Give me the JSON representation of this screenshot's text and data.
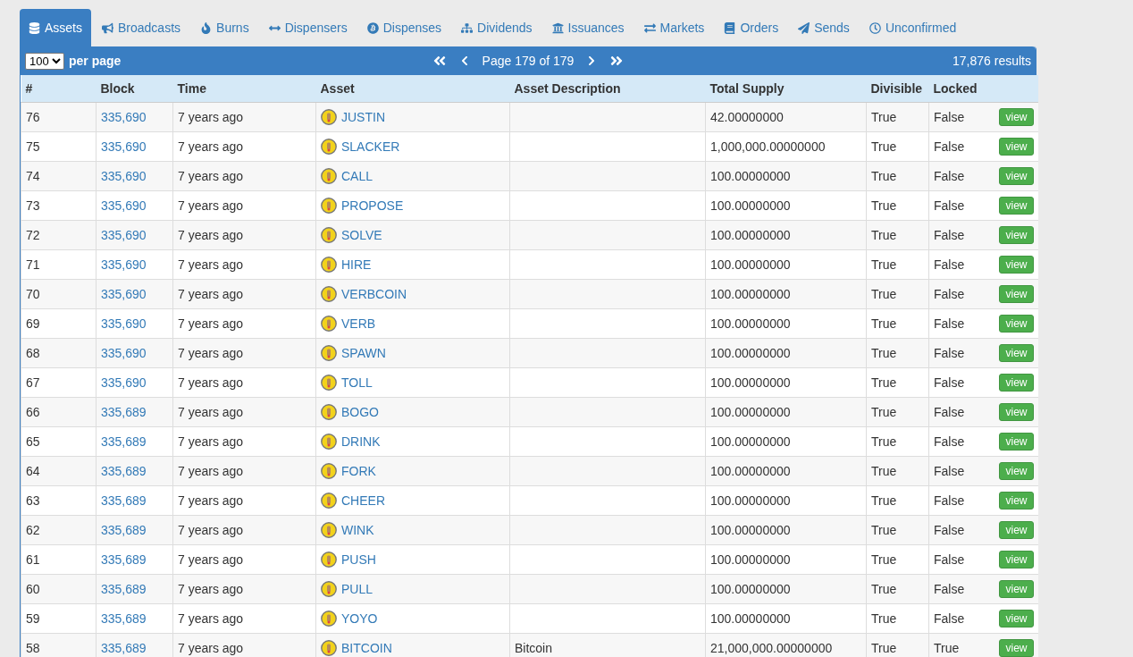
{
  "tabs": [
    {
      "label": "Assets",
      "selected": true
    },
    {
      "label": "Broadcasts",
      "selected": false
    },
    {
      "label": "Burns",
      "selected": false
    },
    {
      "label": "Dispensers",
      "selected": false
    },
    {
      "label": "Dispenses",
      "selected": false
    },
    {
      "label": "Dividends",
      "selected": false
    },
    {
      "label": "Issuances",
      "selected": false
    },
    {
      "label": "Markets",
      "selected": false
    },
    {
      "label": "Orders",
      "selected": false
    },
    {
      "label": "Sends",
      "selected": false
    },
    {
      "label": "Unconfirmed",
      "selected": false
    }
  ],
  "toolbar": {
    "per_page": "100",
    "per_page_label": "per page",
    "page": "Page 179 of 179",
    "results": "17,876 results"
  },
  "table": {
    "columns": [
      "#",
      "Block",
      "Time",
      "Asset",
      "Asset Description",
      "Total Supply",
      "Divisible",
      "Locked"
    ],
    "rows": [
      {
        "num": "76",
        "block": "335,690",
        "time": "7 years ago",
        "asset": "JUSTIN",
        "description": "",
        "supply": "42.00000000",
        "divisible": "True",
        "locked": "False",
        "action": "view"
      },
      {
        "num": "75",
        "block": "335,690",
        "time": "7 years ago",
        "asset": "SLACKER",
        "description": "",
        "supply": "1,000,000.00000000",
        "divisible": "True",
        "locked": "False",
        "action": "view"
      },
      {
        "num": "74",
        "block": "335,690",
        "time": "7 years ago",
        "asset": "CALL",
        "description": "",
        "supply": "100.00000000",
        "divisible": "True",
        "locked": "False",
        "action": "view"
      },
      {
        "num": "73",
        "block": "335,690",
        "time": "7 years ago",
        "asset": "PROPOSE",
        "description": "",
        "supply": "100.00000000",
        "divisible": "True",
        "locked": "False",
        "action": "view"
      },
      {
        "num": "72",
        "block": "335,690",
        "time": "7 years ago",
        "asset": "SOLVE",
        "description": "",
        "supply": "100.00000000",
        "divisible": "True",
        "locked": "False",
        "action": "view"
      },
      {
        "num": "71",
        "block": "335,690",
        "time": "7 years ago",
        "asset": "HIRE",
        "description": "",
        "supply": "100.00000000",
        "divisible": "True",
        "locked": "False",
        "action": "view"
      },
      {
        "num": "70",
        "block": "335,690",
        "time": "7 years ago",
        "asset": "VERBCOIN",
        "description": "",
        "supply": "100.00000000",
        "divisible": "True",
        "locked": "False",
        "action": "view"
      },
      {
        "num": "69",
        "block": "335,690",
        "time": "7 years ago",
        "asset": "VERB",
        "description": "",
        "supply": "100.00000000",
        "divisible": "True",
        "locked": "False",
        "action": "view"
      },
      {
        "num": "68",
        "block": "335,690",
        "time": "7 years ago",
        "asset": "SPAWN",
        "description": "",
        "supply": "100.00000000",
        "divisible": "True",
        "locked": "False",
        "action": "view"
      },
      {
        "num": "67",
        "block": "335,690",
        "time": "7 years ago",
        "asset": "TOLL",
        "description": "",
        "supply": "100.00000000",
        "divisible": "True",
        "locked": "False",
        "action": "view"
      },
      {
        "num": "66",
        "block": "335,689",
        "time": "7 years ago",
        "asset": "BOGO",
        "description": "",
        "supply": "100.00000000",
        "divisible": "True",
        "locked": "False",
        "action": "view"
      },
      {
        "num": "65",
        "block": "335,689",
        "time": "7 years ago",
        "asset": "DRINK",
        "description": "",
        "supply": "100.00000000",
        "divisible": "True",
        "locked": "False",
        "action": "view"
      },
      {
        "num": "64",
        "block": "335,689",
        "time": "7 years ago",
        "asset": "FORK",
        "description": "",
        "supply": "100.00000000",
        "divisible": "True",
        "locked": "False",
        "action": "view"
      },
      {
        "num": "63",
        "block": "335,689",
        "time": "7 years ago",
        "asset": "CHEER",
        "description": "",
        "supply": "100.00000000",
        "divisible": "True",
        "locked": "False",
        "action": "view"
      },
      {
        "num": "62",
        "block": "335,689",
        "time": "7 years ago",
        "asset": "WINK",
        "description": "",
        "supply": "100.00000000",
        "divisible": "True",
        "locked": "False",
        "action": "view"
      },
      {
        "num": "61",
        "block": "335,689",
        "time": "7 years ago",
        "asset": "PUSH",
        "description": "",
        "supply": "100.00000000",
        "divisible": "True",
        "locked": "False",
        "action": "view"
      },
      {
        "num": "60",
        "block": "335,689",
        "time": "7 years ago",
        "asset": "PULL",
        "description": "",
        "supply": "100.00000000",
        "divisible": "True",
        "locked": "False",
        "action": "view"
      },
      {
        "num": "59",
        "block": "335,689",
        "time": "7 years ago",
        "asset": "YOYO",
        "description": "",
        "supply": "100.00000000",
        "divisible": "True",
        "locked": "False",
        "action": "view"
      },
      {
        "num": "58",
        "block": "335,689",
        "time": "7 years ago",
        "asset": "BITCOIN",
        "description": "Bitcoin",
        "supply": "21,000,000.00000000",
        "divisible": "True",
        "locked": "True",
        "action": "view"
      }
    ]
  }
}
